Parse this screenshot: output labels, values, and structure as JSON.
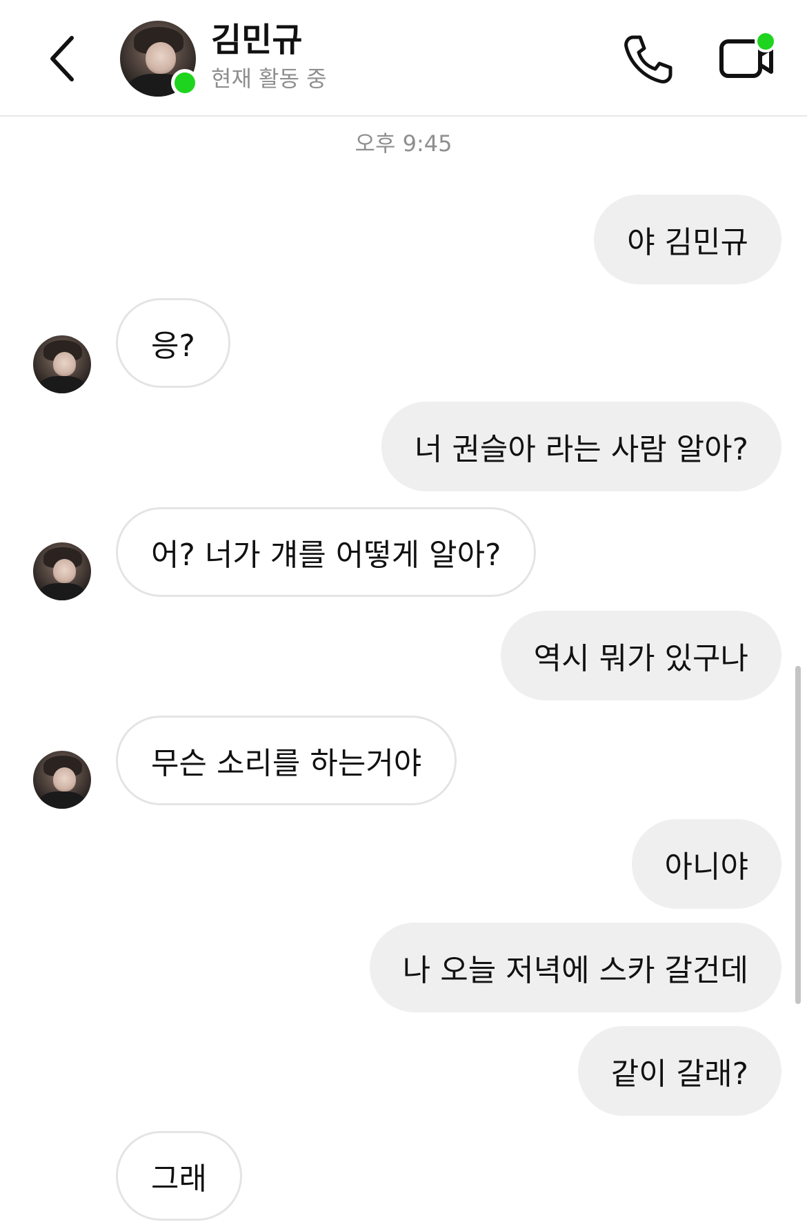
{
  "header": {
    "contact_name": "김민규",
    "status": "현재 활동 중"
  },
  "timestamp": "오후 9:45",
  "messages": [
    {
      "direction": "out",
      "text": "야 김민규"
    },
    {
      "direction": "in",
      "text": "응?"
    },
    {
      "direction": "out",
      "text": "너 권슬아 라는 사람 알아?"
    },
    {
      "direction": "in",
      "text": "어? 너가 걔를 어떻게 알아?"
    },
    {
      "direction": "out",
      "text": "역시 뭐가 있구나"
    },
    {
      "direction": "in",
      "text": "무슨 소리를 하는거야"
    },
    {
      "direction": "out",
      "text": "아니야"
    },
    {
      "direction": "out",
      "text": "나 오늘 저녁에 스카 갈건데"
    },
    {
      "direction": "out",
      "text": "같이 갈래?"
    },
    {
      "direction": "in",
      "text": "그래"
    }
  ],
  "icons": {
    "back": "chevron-left-icon",
    "call": "phone-icon",
    "video": "video-camera-icon"
  },
  "colors": {
    "online": "#1fd41f",
    "outgoing_bubble": "#efefef",
    "incoming_border": "#e4e4e4",
    "secondary_text": "#8e8e8e"
  }
}
